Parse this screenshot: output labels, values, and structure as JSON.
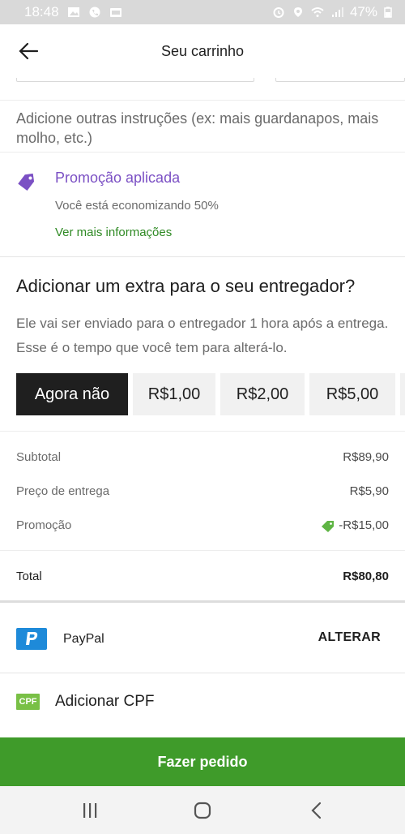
{
  "status_bar": {
    "time": "18:48",
    "battery": "47%"
  },
  "header": {
    "title": "Seu carrinho"
  },
  "instructions": {
    "placeholder": "Adicione outras instruções (ex: mais guardanapos, mais molho, etc.)"
  },
  "promotion": {
    "title": "Promoção aplicada",
    "subtitle": "Você está economizando 50%",
    "link": "Ver mais informações",
    "color": "#7b50c4"
  },
  "tip": {
    "title": "Adicionar um extra para o seu entregador?",
    "description": "Ele vai ser enviado para o entregador 1 hora após a entrega. Esse é o tempo que você tem para alterá-lo.",
    "options": [
      "Agora não",
      "R$1,00",
      "R$2,00",
      "R$5,00"
    ],
    "selected": "Agora não"
  },
  "summary": {
    "subtotal_label": "Subtotal",
    "subtotal_value": "R$89,90",
    "delivery_label": "Preço de entrega",
    "delivery_value": "R$5,90",
    "promo_label": "Promoção",
    "promo_value": "-R$15,00",
    "total_label": "Total",
    "total_value": "R$80,80"
  },
  "payment": {
    "method": "PayPal",
    "change_label": "ALTERAR"
  },
  "cpf": {
    "badge": "CPF",
    "label": "Adicionar CPF"
  },
  "cta": {
    "label": "Fazer pedido",
    "color": "#3f9b2a"
  }
}
